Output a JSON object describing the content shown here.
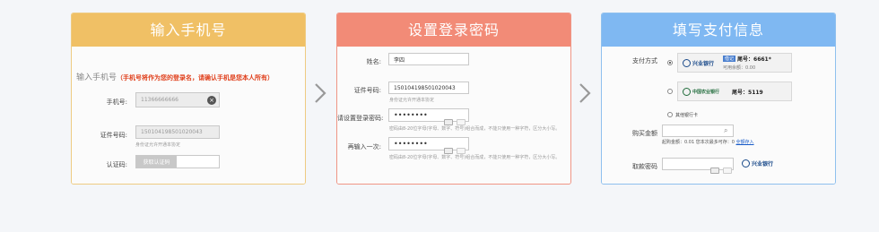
{
  "steps": [
    {
      "title": "输入手机号",
      "intro_prefix": "输入手机号",
      "intro_notice": "（手机号将作为您的登录名，请确认手机是您本人所有）",
      "phone_label": "手机号:",
      "phone_value": "11366666666",
      "id_label": "证件号码:",
      "id_value": "150104198501020043",
      "id_hint": "身份证允许开通本协定",
      "code_label": "认证码:",
      "code_button": "获取认证码"
    },
    {
      "title": "设置登录密码",
      "name_label": "姓名:",
      "name_value": "李四",
      "id_label": "证件号码:",
      "id_value": "150104198501020043",
      "id_hint": "身份证允许开通本协定",
      "pwd_label": "请设置登录密码:",
      "pwd_value": "••••••••",
      "pwd_hint": "密码由8-20位字母(字母、数字、符号)组合而成，不能只使用一种字符，区分大小写。",
      "confirm_label": "再输入一次:",
      "confirm_value": "••••••••",
      "confirm_hint": "密码由8-20位字母(字母、数字、符号)组合而成，不能只使用一种字符，区分大小写。"
    },
    {
      "title": "填写支付信息",
      "method_label": "支付方式",
      "bank1_name": "兴业银行",
      "bank1_tag": "借记",
      "bank1_tail": "尾号：6661*",
      "bank1_balance": "可用余额：0.00",
      "bank2_name": "中国农业银行",
      "bank2_tail": "尾号：5119",
      "other_bank": "其他银行卡",
      "amount_label": "购买金额",
      "amount_hint": "起购金额：0.01  您本次最多可存：0",
      "amount_link": "全额存入",
      "trade_pwd_label": "取款密码",
      "trade_bank": "兴业银行"
    }
  ],
  "icons": {
    "arrow": "chevron-right-icon",
    "clear": "clear-icon",
    "keyboard": "keyboard-icon",
    "bank": "bank-logo-icon"
  },
  "colors": {
    "step1": "#f0c065",
    "step2": "#f28b77",
    "step3": "#7fb8f2",
    "notice": "#e0401c"
  }
}
